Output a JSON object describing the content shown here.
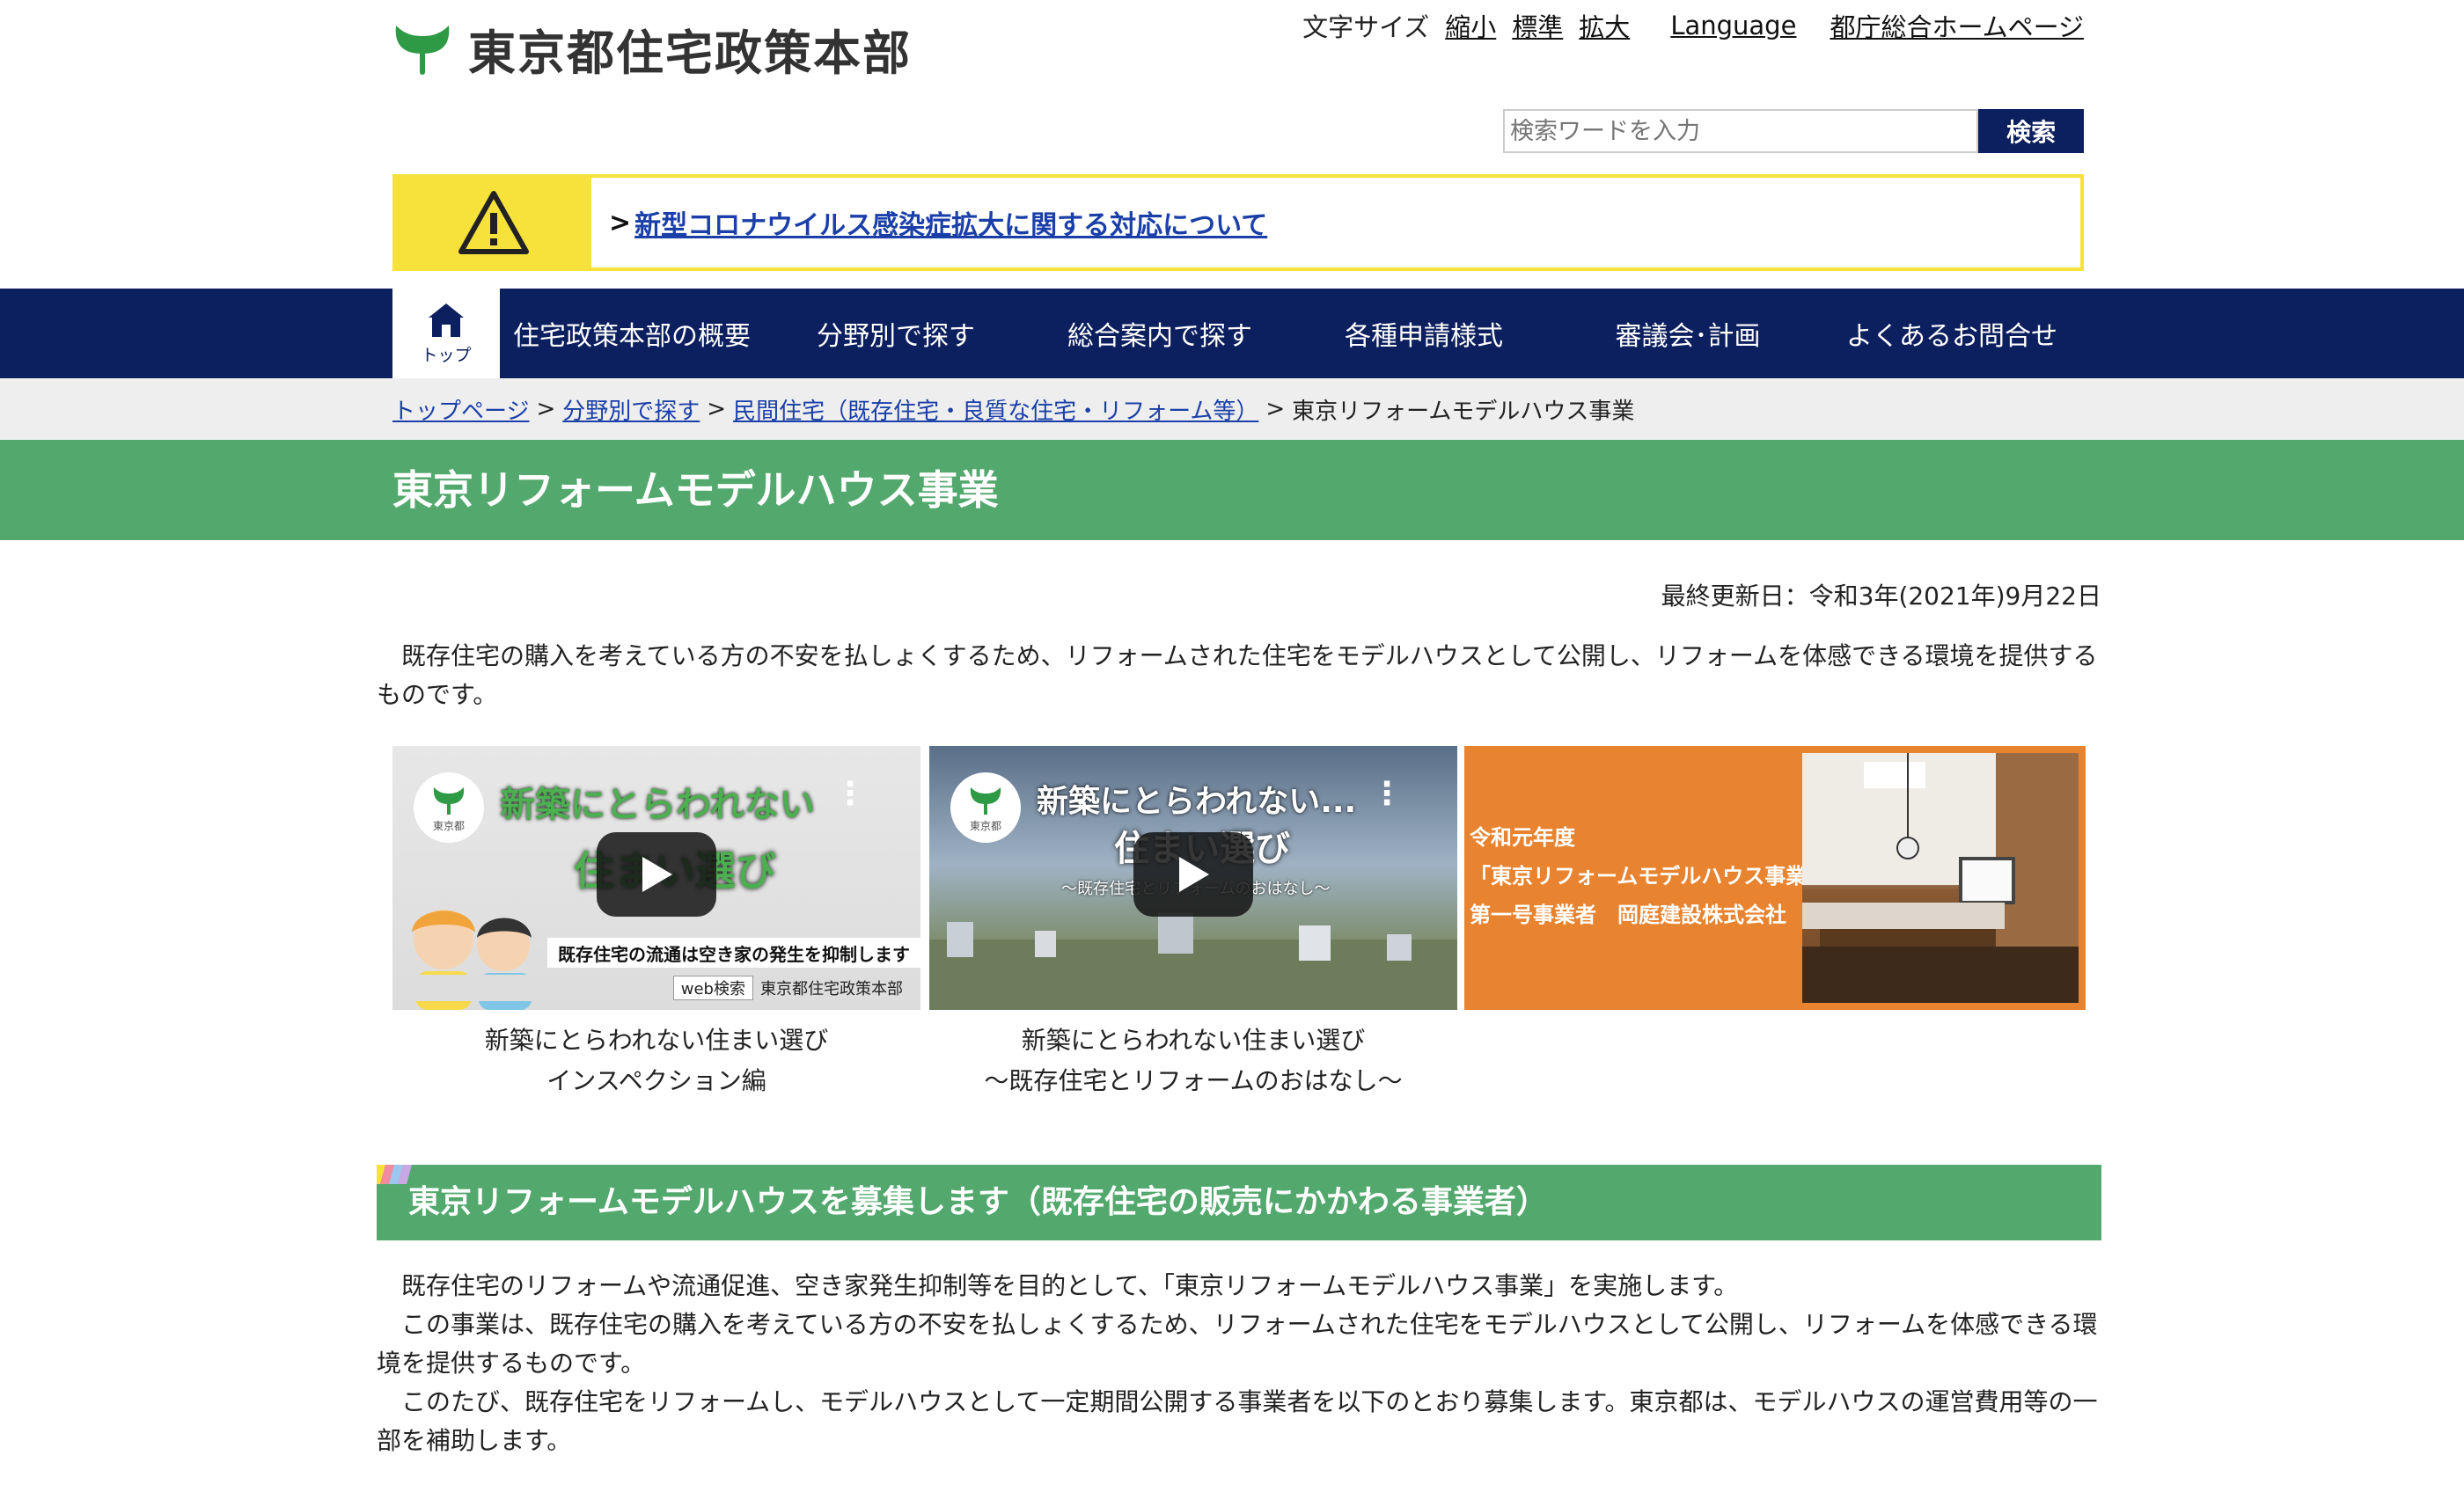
{
  "header": {
    "logo_text": "東京都住宅政策本部",
    "font_size_label": "文字サイズ",
    "size_small": "縮小",
    "size_standard": "標準",
    "size_large": "拡大",
    "language": "Language",
    "metro_home": "都庁総合ホームページ",
    "search_placeholder": "検索ワードを入力",
    "search_button": "検索"
  },
  "alert": {
    "marker": ">",
    "link": "新型コロナウイルス感染症拡大に関する対応について"
  },
  "nav": {
    "home_label": "トップ",
    "items": [
      "住宅政策本部の概要",
      "分野別で探す",
      "総合案内で探す",
      "各種申請様式",
      "審議会･計画",
      "よくあるお問合せ"
    ]
  },
  "breadcrumb": {
    "items": [
      "トップページ",
      "分野別で探す",
      "民間住宅（既存住宅・良質な住宅・リフォーム等）"
    ],
    "separator": ">",
    "current": "東京リフォームモデルハウス事業"
  },
  "page": {
    "title": "東京リフォームモデルハウス事業",
    "updated": "最終更新日：令和3年(2021年)9月22日",
    "intro": "　既存住宅の購入を考えている方の不安を払しょくするため、リフォームされた住宅をモデルハウスとして公開し、リフォームを体感できる環境を提供するものです。"
  },
  "videos": [
    {
      "title_overlay": "新築にとらわれない",
      "title_overlay2": "住まい選び",
      "channel": "東京都",
      "strip_text": "既存住宅の流通は空き家の発生を抑制します",
      "web_search": "web検索",
      "org": "東京都住宅政策本部",
      "caption1": "新築にとらわれない住まい選び",
      "caption2": "インスペクション編"
    },
    {
      "title_overlay": "新築にとらわれない...",
      "title_overlay2": "住まい選び",
      "channel": "東京都",
      "subtitle": "～既存住宅とリフォームのおはなし～",
      "caption1": "新築にとらわれない住まい選び",
      "caption2": "～既存住宅とリフォームのおはなし～"
    }
  ],
  "banner": {
    "line1": "令和元年度",
    "line2": "「東京リフォームモデルハウス事業」",
    "line3": "第一号事業者　岡庭建設株式会社"
  },
  "section": {
    "heading": "東京リフォームモデルハウスを募集します（既存住宅の販売にかかわる事業者）",
    "p1": "　既存住宅のリフォームや流通促進、空き家発生抑制等を目的として、「東京リフォームモデルハウス事業」を実施します。",
    "p2": "　この事業は、既存住宅の購入を考えている方の不安を払しょくするため、リフォームされた住宅をモデルハウスとして公開し、リフォームを体感できる環境を提供するものです。",
    "p3": "　このたび、既存住宅をリフォームし、モデルハウスとして一定期間公開する事業者を以下のとおり募集します。東京都は、モデルハウスの運営費用等の一部を補助します。"
  },
  "colors": {
    "navy": "#0c1f5e",
    "green": "#53a86e",
    "alert_yellow": "#f7e23b",
    "banner_orange": "#e8832f",
    "link": "#1a3fa8"
  }
}
